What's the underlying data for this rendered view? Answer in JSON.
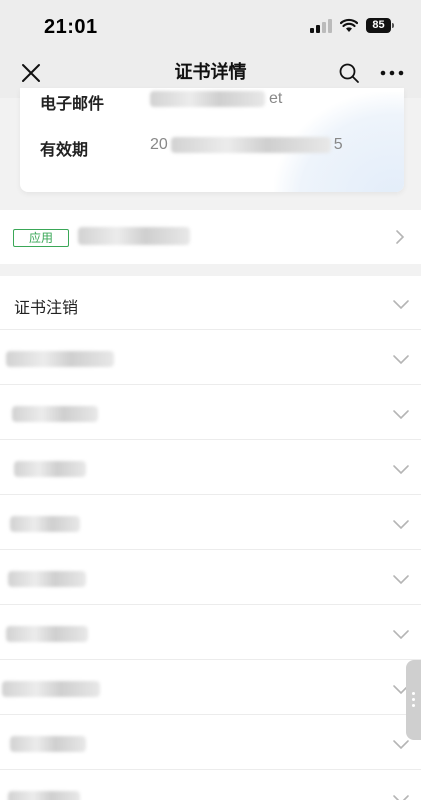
{
  "status_bar": {
    "time": "21:01",
    "battery": "85"
  },
  "nav": {
    "title": "证书详情",
    "close_icon": "close-icon",
    "search_icon": "search-icon",
    "more_icon": "more-icon"
  },
  "card": {
    "email_label": "电子邮件",
    "email_value_suffix": "et",
    "validity_label": "有效期",
    "validity_value_prefix": "20",
    "validity_value_suffix": "5"
  },
  "app_row": {
    "tag": "应用"
  },
  "list": {
    "revoke_label": "证书注销"
  },
  "colors": {
    "accent_green": "#3aa757",
    "background": "#f2f2f2",
    "nav_background": "#ededed"
  }
}
